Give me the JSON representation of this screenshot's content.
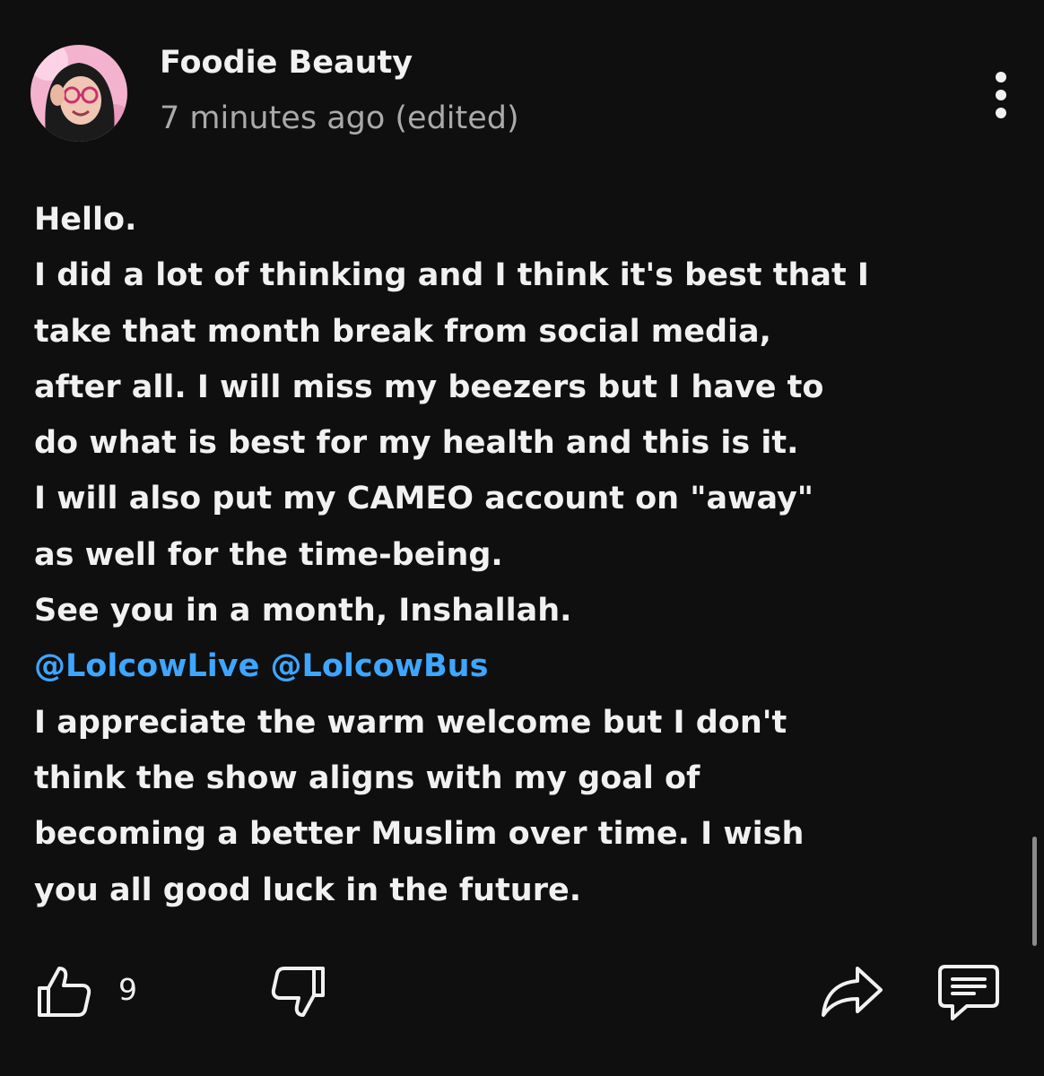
{
  "post": {
    "author": "Foodie Beauty",
    "timestamp": "7 minutes ago (edited)",
    "lines": [
      "Hello.",
      "I did a lot of thinking and I think it's best that I",
      "take that month break from social media,",
      "after all. I will miss my beezers but I have to",
      "do what is best for my health and this is it.",
      "I will also put my CAMEO account on \"away\"",
      "as well for the time-being.",
      "See you in a month, Inshallah."
    ],
    "mentions": [
      "@LolcowLive",
      "@LolcowBus"
    ],
    "closing_lines": [
      "I appreciate the warm welcome but I don't",
      "think the show aligns with my goal of",
      "becoming a better Muslim over time. I wish",
      "you all good luck in the future."
    ]
  },
  "actions": {
    "like_count": "9"
  },
  "colors": {
    "background": "#0f0f0f",
    "text": "#f1f1f1",
    "secondary_text": "#aaaaaa",
    "mention": "#3ea6ff"
  },
  "icons": [
    "avatar",
    "more-vertical-icon",
    "thumbs-up-icon",
    "thumbs-down-icon",
    "share-icon",
    "comment-icon"
  ]
}
